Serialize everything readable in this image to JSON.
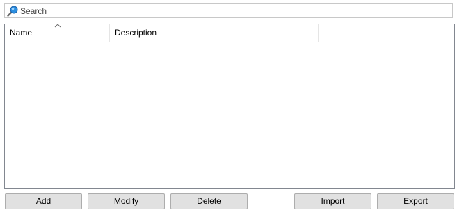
{
  "search": {
    "placeholder": "Search",
    "icon": "search-icon",
    "icon_color": "#1e8fe0"
  },
  "table": {
    "columns": [
      {
        "label": "Name",
        "sorted": "ascending"
      },
      {
        "label": "Description"
      }
    ],
    "rows": []
  },
  "buttons": {
    "add": "Add",
    "modify": "Modify",
    "delete": "Delete",
    "import": "Import",
    "export": "Export"
  }
}
